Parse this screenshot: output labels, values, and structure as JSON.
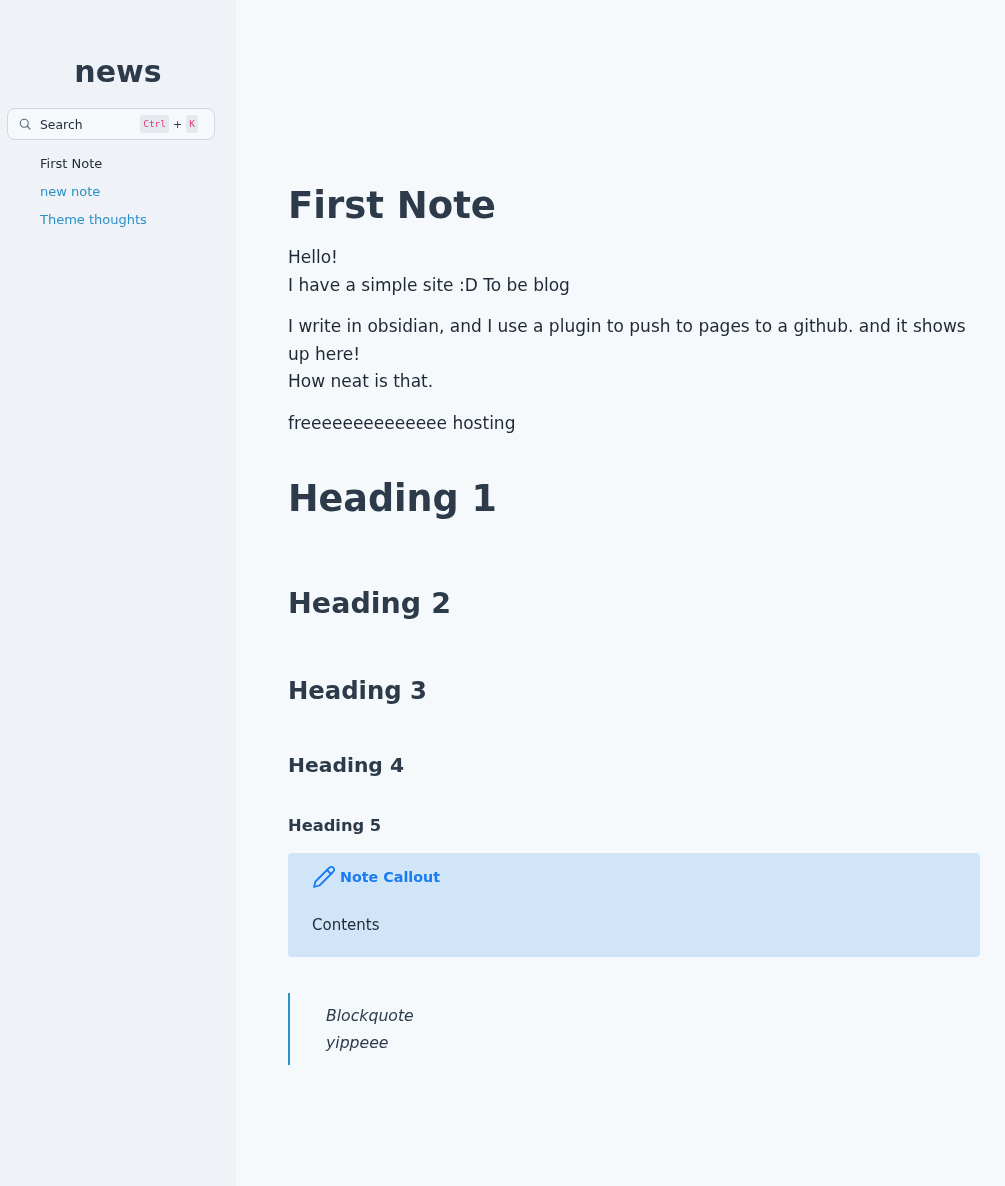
{
  "sidebar": {
    "title": "news",
    "search": {
      "label": "Search",
      "shortcut": [
        {
          "kind": "key",
          "text": "Ctrl"
        },
        {
          "kind": "separator",
          "text": "+"
        },
        {
          "kind": "key",
          "text": "K"
        }
      ]
    },
    "items": [
      {
        "label": "First Note",
        "selected": true
      },
      {
        "label": "new note",
        "selected": false
      },
      {
        "label": "Theme thoughts",
        "selected": false
      }
    ]
  },
  "note": {
    "title": "First Note",
    "blocks": [
      {
        "kind": "paragraph",
        "lines": [
          "Hello!",
          "I have a simple site :D To be blog"
        ]
      },
      {
        "kind": "paragraph",
        "lines": [
          "I write in obsidian, and I use a plugin to push to pages to a github. and it shows up here!",
          "How neat is that."
        ]
      },
      {
        "kind": "paragraph",
        "lines": [
          "freeeeeeeeeeeeee hosting"
        ]
      },
      {
        "kind": "h1",
        "text": "Heading 1"
      },
      {
        "kind": "h2",
        "text": "Heading 2"
      },
      {
        "kind": "h3",
        "text": "Heading 3"
      },
      {
        "kind": "h4",
        "text": "Heading 4"
      },
      {
        "kind": "h5",
        "text": "Heading 5"
      },
      {
        "kind": "callout",
        "title": "Note Callout",
        "body": "Contents"
      },
      {
        "kind": "quote",
        "lines": [
          "Blockquote",
          "yippeee"
        ]
      }
    ]
  }
}
